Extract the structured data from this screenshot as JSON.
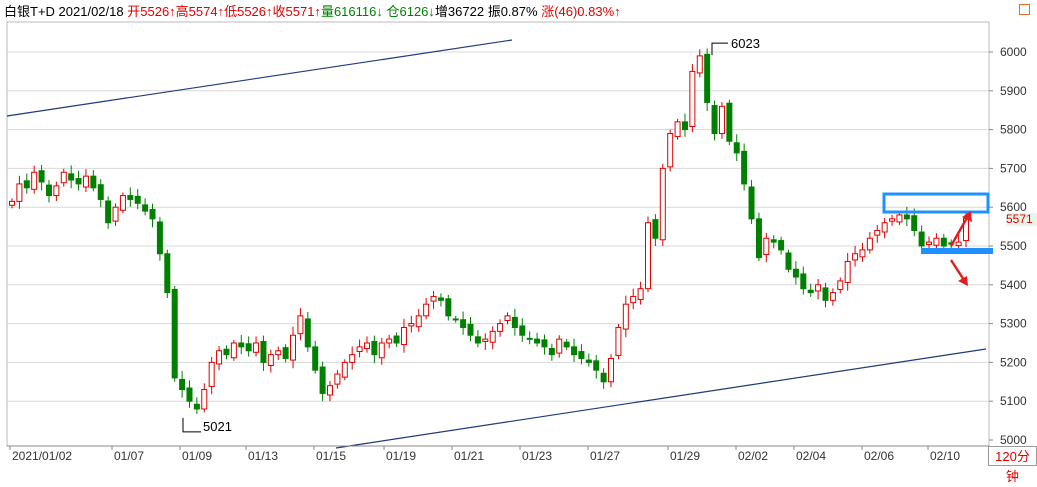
{
  "header": {
    "instrument": "白银T+D",
    "date": "2021/02/18",
    "open": "开5526↑",
    "high": "高5574↑",
    "low": "低5526↑",
    "close": "收5571↑",
    "volume": "量616116↓",
    "position": "仓6126↓",
    "increase": "增36722",
    "amplitude": "振0.87%",
    "change": "涨(46)0.83%↑"
  },
  "price_tag": "5571",
  "period_label": "120分钟",
  "colors": {
    "up": "#e00000",
    "down": "#008000",
    "highlight_box": "#1e90ff",
    "arrow": "#e02020",
    "trendline": "#1f3a7a"
  },
  "chart_data": {
    "type": "candlestick",
    "ylim": [
      5000,
      6060
    ],
    "yticks": [
      "6000",
      "5900",
      "5800",
      "5700",
      "5600",
      "5500",
      "5400",
      "5300",
      "5200",
      "5100",
      "5000"
    ],
    "xlabels": [
      "2021/01/02",
      "01/07",
      "01/09",
      "01/13",
      "01/15",
      "01/19",
      "01/21",
      "01/23",
      "01/27",
      "01/29",
      "02/02",
      "02/04",
      "02/06",
      "02/10"
    ],
    "annotations": [
      {
        "label": "6023",
        "value": 6023
      },
      {
        "label": "5021",
        "value": 5021
      }
    ],
    "closes": [
      5615,
      5660,
      5650,
      5690,
      5665,
      5630,
      5655,
      5690,
      5670,
      5660,
      5680,
      5650,
      5620,
      5560,
      5600,
      5630,
      5620,
      5610,
      5590,
      5570,
      5480,
      5380,
      5160,
      5130,
      5100,
      5080,
      5130,
      5200,
      5230,
      5220,
      5250,
      5240,
      5230,
      5250,
      5200,
      5220,
      5230,
      5210,
      5270,
      5320,
      5240,
      5180,
      5120,
      5140,
      5170,
      5200,
      5220,
      5240,
      5250,
      5220,
      5250,
      5260,
      5250,
      5290,
      5300,
      5320,
      5350,
      5370,
      5360,
      5320,
      5310,
      5290,
      5270,
      5250,
      5260,
      5280,
      5300,
      5320,
      5290,
      5270,
      5260,
      5250,
      5240,
      5220,
      5260,
      5240,
      5220,
      5210,
      5200,
      5180,
      5150,
      5210,
      5290,
      5350,
      5370,
      5390,
      5560,
      5520,
      5700,
      5790,
      5820,
      5800,
      5950,
      5990,
      5870,
      5790,
      5860,
      5770,
      5740,
      5660,
      5570,
      5470,
      5520,
      5510,
      5490,
      5440,
      5420,
      5390,
      5380,
      5400,
      5360,
      5380,
      5410,
      5460,
      5480,
      5490,
      5520,
      5540,
      5560,
      5570,
      5580,
      5570,
      5540,
      5500,
      5510,
      5520,
      5500,
      5505,
      5510,
      5571
    ]
  }
}
